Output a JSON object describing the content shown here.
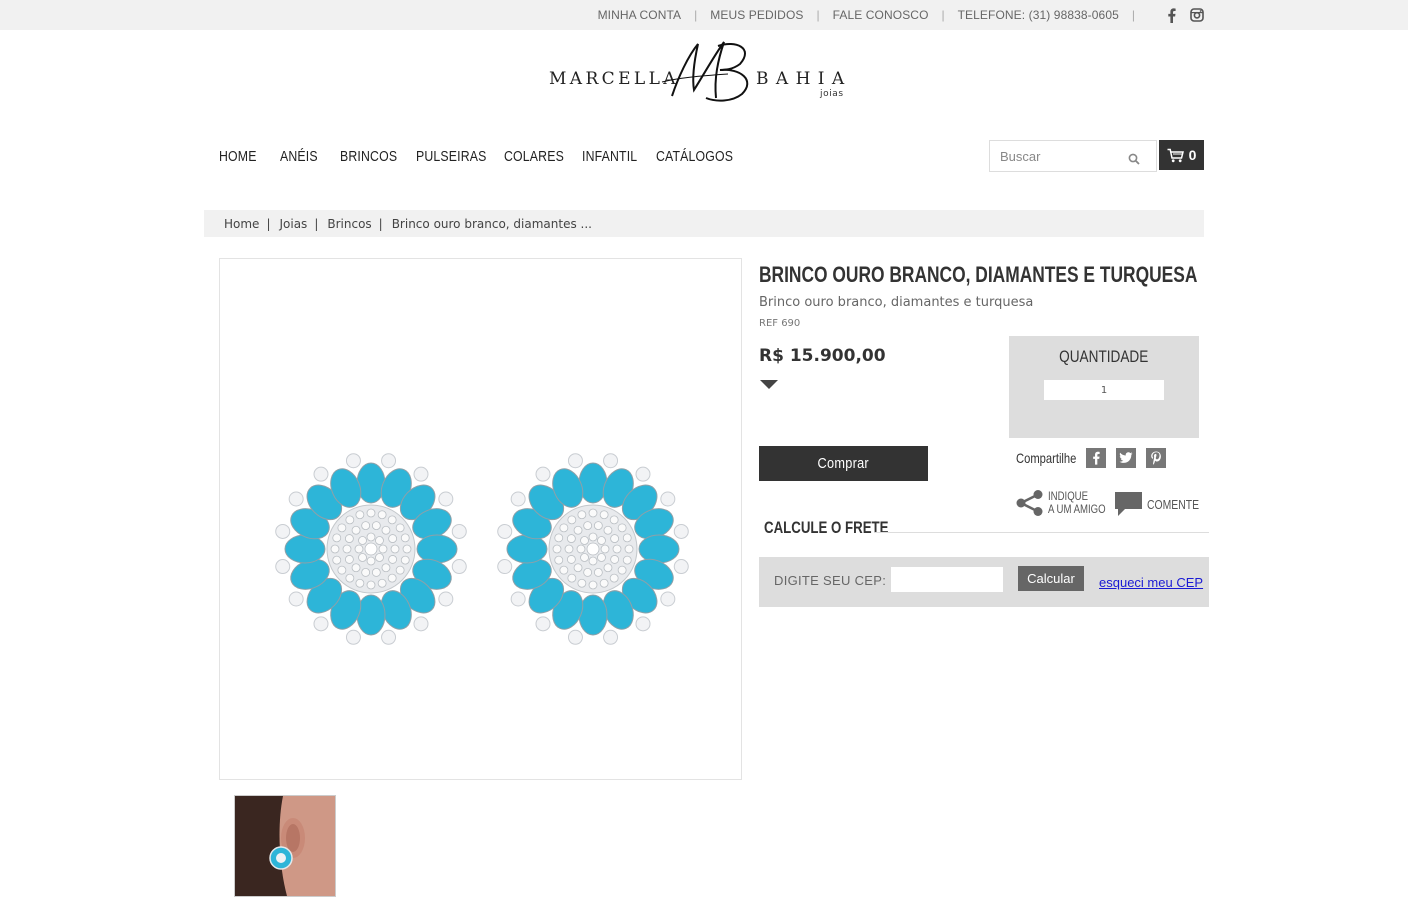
{
  "topbar": {
    "links": [
      "MINHA CONTA",
      "MEUS PEDIDOS",
      "FALE CONOSCO",
      "TELEFONE: (31) 98838-0605"
    ],
    "social_icons": [
      "facebook-icon",
      "instagram-icon"
    ]
  },
  "logo": {
    "left_word": "MARCELLA",
    "monogram": "MB",
    "right_word": "BAHIA",
    "tagline": "joias"
  },
  "nav": {
    "items": [
      "HOME",
      "ANÉIS",
      "BRINCOS",
      "PULSEIRAS",
      "COLARES",
      "INFANTIL",
      "CATÁLOGOS"
    ]
  },
  "search": {
    "placeholder": "Buscar",
    "icon": "search-icon"
  },
  "cart": {
    "count": "0",
    "icon": "cart-icon"
  },
  "breadcrumb": [
    "Home",
    "Joias",
    "Brincos",
    "Brinco ouro branco, diamantes ..."
  ],
  "product": {
    "title": "BRINCO OURO BRANCO, DIAMANTES E TURQUESA",
    "subtitle": "Brinco ouro branco, diamantes e turquesa",
    "ref": "REF 690",
    "price": "R$ 15.900,00",
    "buy_label": "Comprar"
  },
  "quantity": {
    "label": "QUANTIDADE",
    "value": "1"
  },
  "share": {
    "label": "Compartilhe",
    "icons": [
      "facebook-icon",
      "twitter-icon",
      "pinterest-icon"
    ]
  },
  "actions": {
    "indique_line1": "INDIQUE",
    "indique_line2": "A UM AMIGO",
    "comente": "COMENTE"
  },
  "shipping": {
    "title": "CALCULE O FRETE",
    "cep_label": "DIGITE SEU CEP:",
    "cep_value": "",
    "calc_label": "Calcular",
    "forgot_label": "esqueci meu CEP"
  },
  "colors": {
    "dark": "#333333",
    "turquoise": "#2db5d8",
    "panel": "#dddddd",
    "link": "#1a1ad4"
  }
}
